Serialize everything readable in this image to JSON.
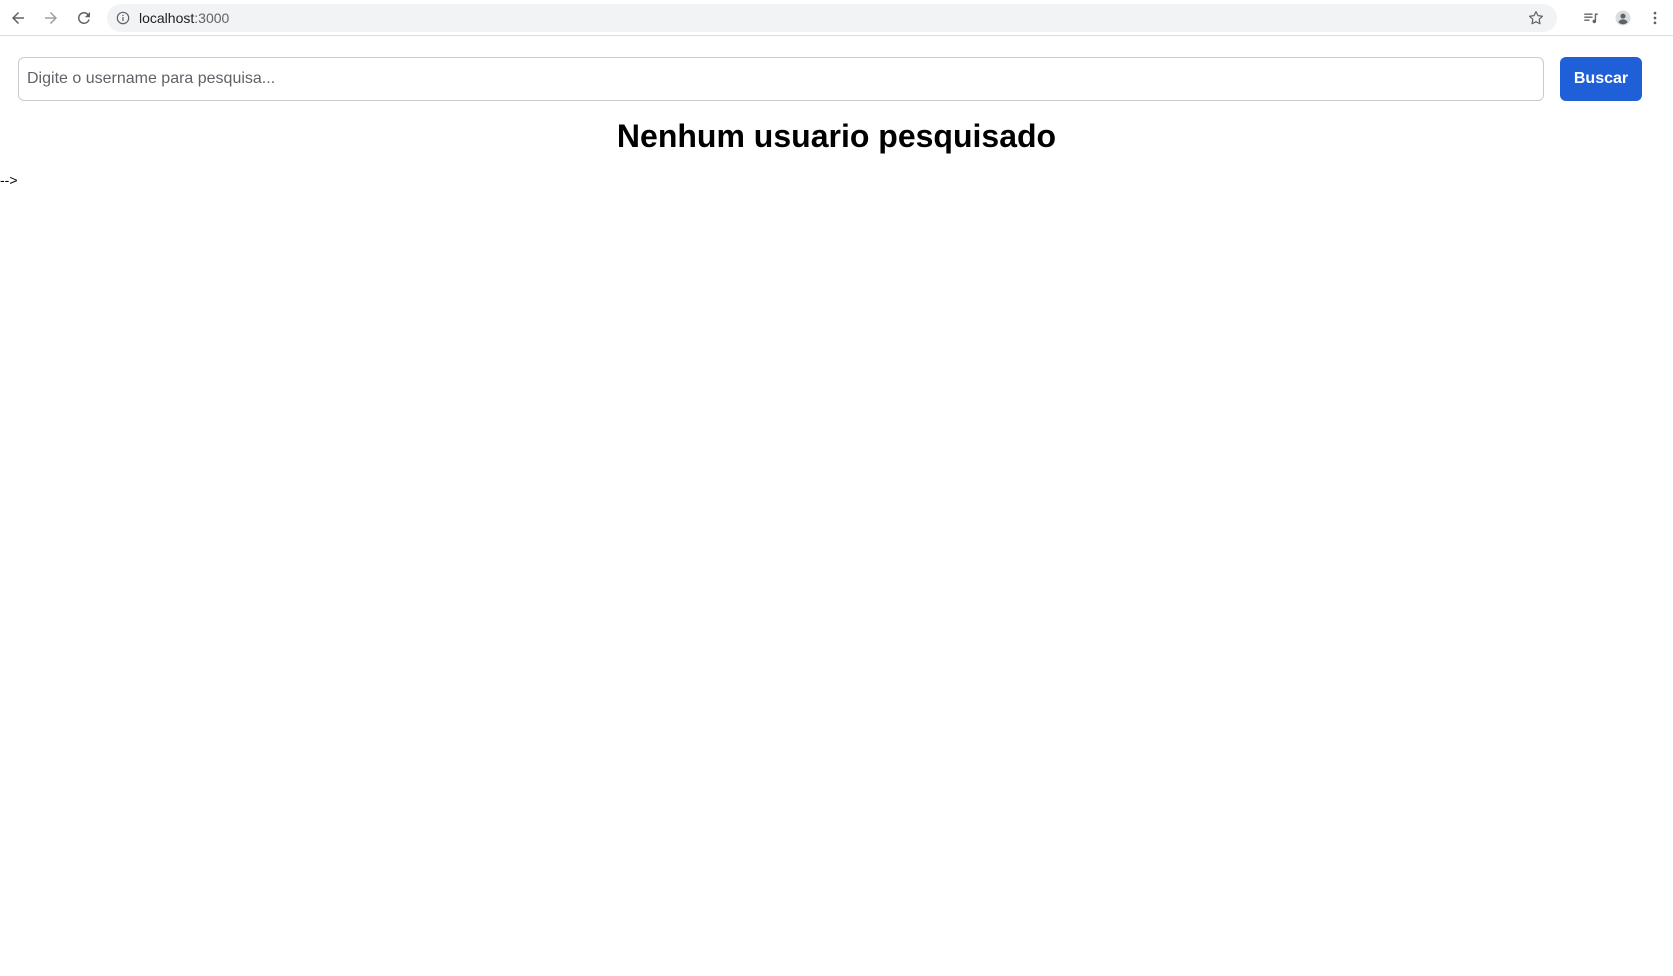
{
  "browser": {
    "url_host": "localhost",
    "url_port": ":3000",
    "icons": {
      "back": "arrow-left-icon",
      "forward": "arrow-right-icon",
      "reload": "reload-icon",
      "site_info": "info-icon",
      "bookmark": "star-icon",
      "reading_list": "reading-list-icon",
      "profile": "profile-icon",
      "menu": "more-vertical-icon"
    }
  },
  "search": {
    "placeholder": "Digite o username para pesquisa...",
    "value": "",
    "button_label": "Buscar"
  },
  "main": {
    "empty_message": "Nenhum usuario pesquisado",
    "stray_text": "-->"
  },
  "colors": {
    "button_bg": "#1f5fd8",
    "button_text": "#ffffff",
    "omnibox_bg": "#f1f3f4"
  }
}
